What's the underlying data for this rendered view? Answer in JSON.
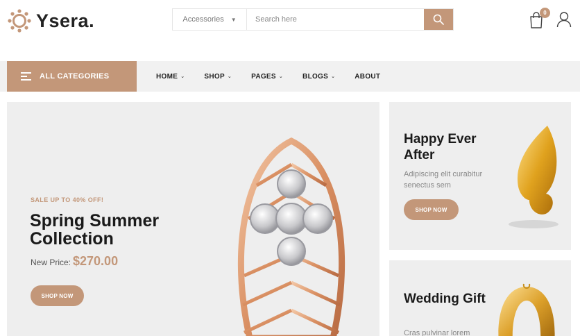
{
  "brand": {
    "name": "Ysera.",
    "accent": "#c39779"
  },
  "search": {
    "category": "Accessories",
    "placeholder": "Search here"
  },
  "cart": {
    "count": "0"
  },
  "nav": {
    "all_categories": "ALL CATEGORIES",
    "items": [
      {
        "label": "HOME",
        "dropdown": true
      },
      {
        "label": "SHOP",
        "dropdown": true
      },
      {
        "label": "PAGES",
        "dropdown": true
      },
      {
        "label": "BLOGS",
        "dropdown": true
      },
      {
        "label": "ABOUT",
        "dropdown": false
      }
    ]
  },
  "hero": {
    "sale": "SALE UP TO 40% OFF!",
    "title": "Spring Summer Collection",
    "price_label": "New Price:",
    "price": "$270.00",
    "button": "SHOP NOW"
  },
  "banners": [
    {
      "title": "Happy Ever After",
      "text": "Adipiscing elit curabitur senectus sem",
      "button": "SHOP NOW"
    },
    {
      "title": "Wedding Gift",
      "text": "Cras pulvinar lorem"
    }
  ],
  "icons": [
    "sun-logo-icon",
    "chevron-down-icon",
    "search-icon",
    "cart-icon",
    "user-icon",
    "menu-bars-icon"
  ]
}
